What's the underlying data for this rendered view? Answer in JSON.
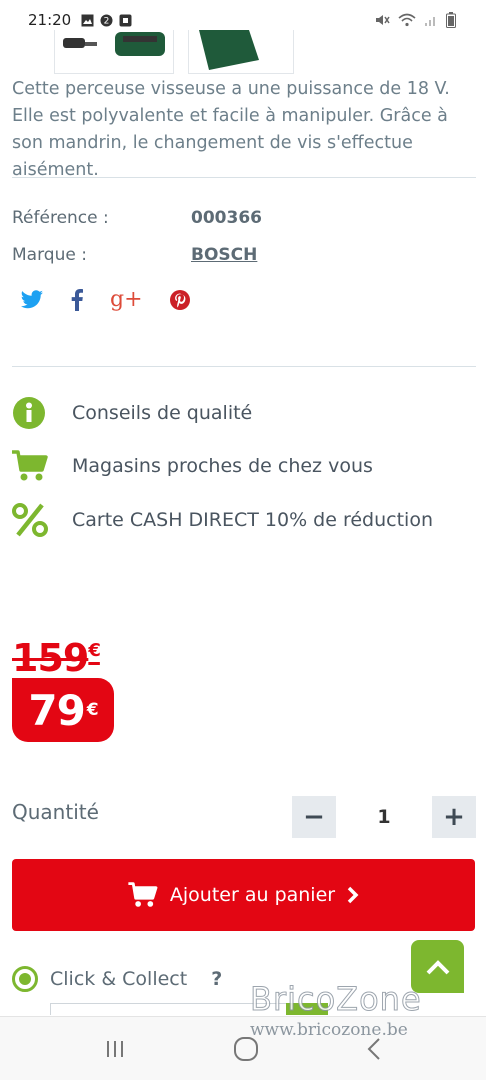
{
  "status_bar": {
    "time": "21:20"
  },
  "product": {
    "description": "Cette perceuse visseuse a une puissance de 18 V. Elle est polyvalente et facile à manipuler. Grâce à son mandrin, le changement de vis s'effectue aisément.",
    "reference_label": "Référence :",
    "reference_value": "000366",
    "brand_label": "Marque :",
    "brand_value": "BOSCH"
  },
  "social": {
    "twitter": "twitter-icon",
    "facebook": "facebook-icon",
    "googleplus": "google-plus-icon",
    "pinterest": "pinterest-icon",
    "googleplus_text": "g+"
  },
  "features": [
    {
      "label": "Conseils de qualité",
      "icon": "info-icon"
    },
    {
      "label": "Magasins proches de chez vous",
      "icon": "cart-icon"
    },
    {
      "label": "Carte CASH DIRECT 10% de réduction",
      "icon": "percent-icon"
    }
  ],
  "pricing": {
    "old_price": "159",
    "old_currency": "€",
    "new_price": "79",
    "new_currency": "€"
  },
  "quantity": {
    "label": "Quantité",
    "value": "1",
    "minus": "−",
    "plus": "+"
  },
  "cart_button": {
    "label": "Ajouter au panier"
  },
  "click_collect": {
    "label": "Click & Collect",
    "help": "?"
  },
  "watermark": {
    "title": "BricoZone",
    "url": "www.bricozone.be"
  },
  "colors": {
    "accent_red": "#e30613",
    "accent_green": "#7db72f",
    "text": "#5d6b75"
  }
}
